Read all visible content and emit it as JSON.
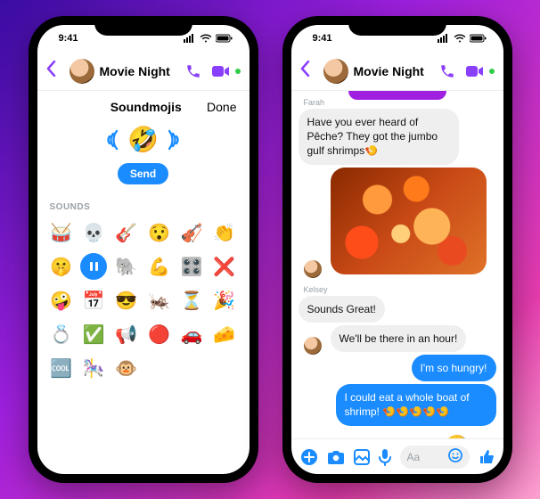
{
  "status": {
    "time": "9:41"
  },
  "header": {
    "title": "Movie Night"
  },
  "left": {
    "panel_title": "Soundmojis",
    "done_label": "Done",
    "preview_emoji": "🤣",
    "send_label": "Send",
    "sounds_label": "SOUNDS",
    "grid": [
      "🥁",
      "💀",
      "🎸",
      "😯",
      "🎻",
      "👏",
      "🤫",
      "PAUSE",
      "🐘",
      "💪",
      "🎛️",
      "❌",
      "🤪",
      "📅",
      "😎",
      "🦗",
      "⏳",
      "🎉",
      "💍",
      "✅",
      "📢",
      "🔴",
      "🚗",
      "🧀",
      "🆒",
      "🎠",
      "🐵"
    ]
  },
  "right": {
    "senders": {
      "farah": "Farah",
      "kelsey": "Kelsey"
    },
    "msg1": "Have you ever heard of Pêche? They got the jumbo gulf shrimps🍤",
    "msg2": "Sounds Great!",
    "msg3": "We'll be there in an hour!",
    "msg4": "I'm so hungry!",
    "msg5": "I could eat a whole boat of shrimp! 🍤🍤🍤🍤🍤",
    "rx_emoji": "🤣",
    "composer_placeholder": "Aa"
  }
}
